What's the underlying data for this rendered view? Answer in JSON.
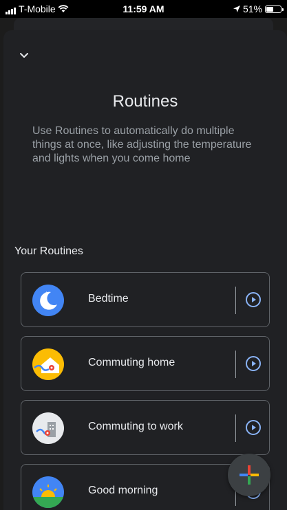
{
  "status_bar": {
    "carrier": "T-Mobile",
    "time": "11:59 AM",
    "battery": "51%",
    "battery_level": 0.51
  },
  "sheet": {
    "title": "Routines",
    "description": "Use Routines to automatically do multiple things at once, like adjusting the temperature and lights when you come home",
    "section_header": "Your Routines"
  },
  "routines": [
    {
      "label": "Bedtime",
      "icon": "moon-icon"
    },
    {
      "label": "Commuting home",
      "icon": "home-icon"
    },
    {
      "label": "Commuting to work",
      "icon": "building-icon"
    },
    {
      "label": "Good morning",
      "icon": "sunrise-icon"
    }
  ],
  "icons": {
    "collapse": "chevron-down-icon",
    "play": "play-circle-icon",
    "fab": "plus-icon"
  },
  "colors": {
    "accent": "#8ab4f8",
    "background": "#202124"
  }
}
